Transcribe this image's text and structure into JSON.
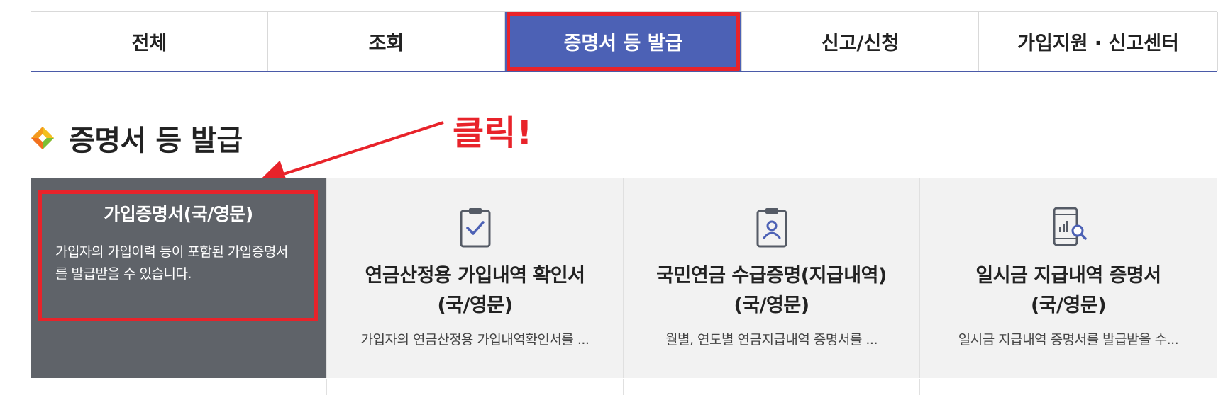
{
  "tabs": [
    {
      "label": "전체"
    },
    {
      "label": "조회"
    },
    {
      "label": "증명서 등 발급"
    },
    {
      "label": "신고/신청"
    },
    {
      "label": "가입지원 · 신고센터"
    }
  ],
  "active_tab_index": 2,
  "section": {
    "title": "증명서 등 발급"
  },
  "annotation": {
    "text": "클릭!",
    "color": "#e8232a"
  },
  "cards": [
    {
      "title": "가입증명서(국/영문)",
      "desc": "가입자의 가입이력 등이 포함된 가입증명서를 발급받을 수 있습니다.",
      "icon": "none"
    },
    {
      "title_line1": "연금산정용 가입내역 확인서",
      "title_line2": "(국/영문)",
      "desc": "가입자의 연금산정용 가입내역확인서를 ...",
      "icon": "clipboard-check-icon"
    },
    {
      "title_line1": "국민연금 수급증명(지급내역)",
      "title_line2": "(국/영문)",
      "desc": "월별, 연도별 연금지급내역 증명서를 ...",
      "icon": "clipboard-person-icon"
    },
    {
      "title_line1": "일시금 지급내역 증명서",
      "title_line2": "(국/영문)",
      "desc": "일시금 지급내역 증명서를 발급받을 수...",
      "icon": "phone-search-icon"
    }
  ],
  "colors": {
    "accent": "#4c61b5",
    "highlight": "#e8232a",
    "hover_card": "#5f6369",
    "card_bg": "#f2f2f2"
  }
}
